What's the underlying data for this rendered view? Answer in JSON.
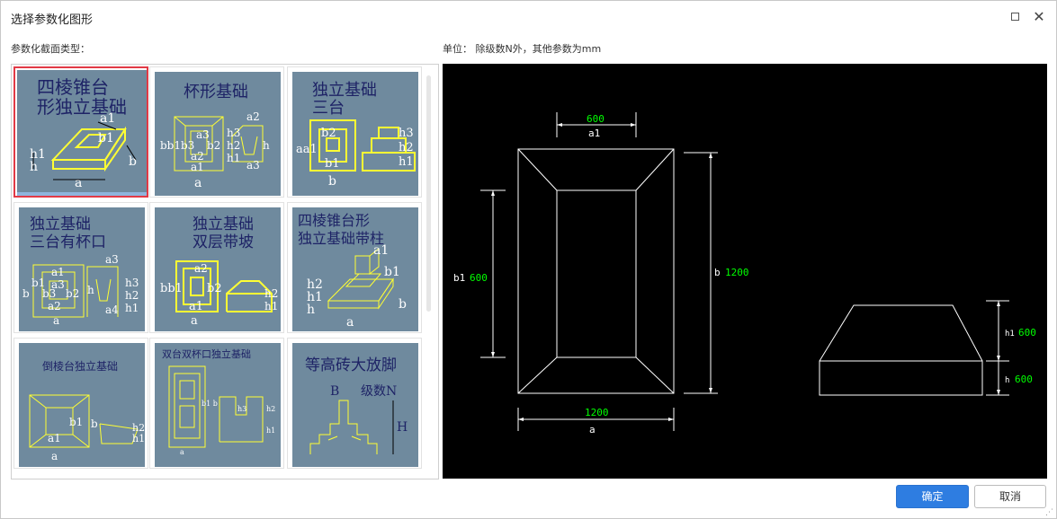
{
  "dialog": {
    "title": "选择参数化图形",
    "section_label": "参数化截面类型：",
    "unit_label": "单位：  除级数N外，其他参数为mm"
  },
  "gallery": {
    "items": [
      {
        "title": "四棱锥台形独立基础",
        "line1": "四棱锥台",
        "line2": "形独立基础",
        "selected": true
      },
      {
        "title": "杯形基础",
        "line1": "杯形基础",
        "line2": ""
      },
      {
        "title": "独立基础三台",
        "line1": "独立基础",
        "line2": "三台"
      },
      {
        "title": "独立基础三台有杯口",
        "line1": "独立基础",
        "line2": "三台有杯口"
      },
      {
        "title": "独立基础双层带坡",
        "line1": "独立基础",
        "line2": "双层带坡"
      },
      {
        "title": "四棱锥台形独立基础带柱",
        "line1": "四棱锥台形",
        "line2": "独立基础带柱"
      },
      {
        "title": "倒棱台独立基础",
        "line1": "倒棱台独立基础",
        "line2": ""
      },
      {
        "title": "双台双杯口独立基础",
        "line1": "双台双杯口独立基础",
        "line2": ""
      },
      {
        "title": "等高砖大放脚",
        "line1": "等高砖大放脚",
        "line2": ""
      }
    ]
  },
  "preview": {
    "a1_value": "600",
    "a1_name": "a1",
    "b1_name": "b1",
    "b1_value": "600",
    "b_name": "b",
    "b_value": "1200",
    "a_value": "1200",
    "a_name": "a",
    "h1_name": "h1",
    "h1_value": "600",
    "h_name": "h",
    "h_value": "600",
    "line_color": "#ffffff",
    "value_color": "#00ff00"
  },
  "buttons": {
    "ok": "确定",
    "cancel": "取消"
  },
  "colors": {
    "accent": "#2e7de1",
    "selected_border": "#e23a46",
    "tile_bg": "#6f8a9e",
    "sketch": "#ffff33"
  }
}
